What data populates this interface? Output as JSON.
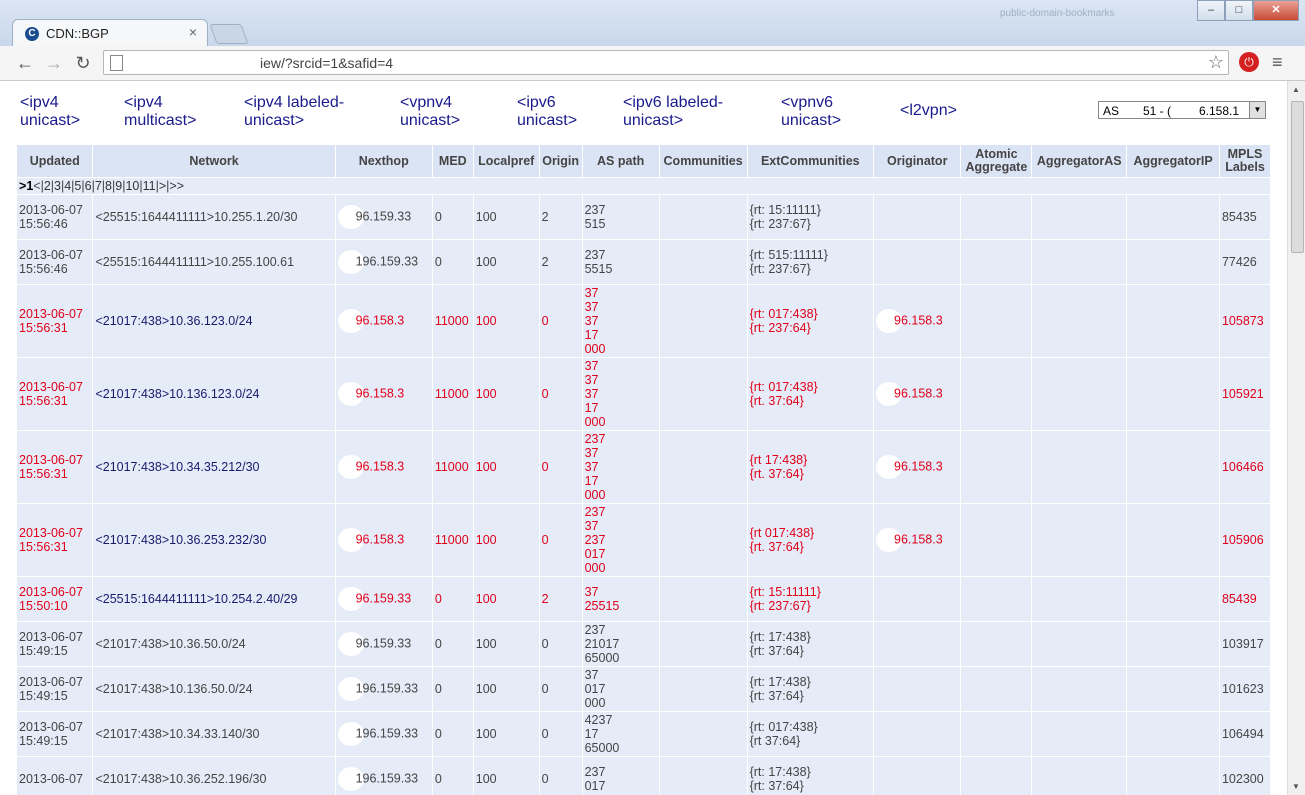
{
  "window": {
    "tab_title": "CDN::BGP",
    "url": "iew/?srcid=1&safid=4",
    "blurred_title": "public-domain-bookmarks"
  },
  "safi_links": [
    {
      "label": "<ipv4\nunicast>"
    },
    {
      "label": "<ipv4\nmulticast>"
    },
    {
      "label": "<ipv4 labeled-\nunicast>"
    },
    {
      "label": "<vpnv4\nunicast>"
    },
    {
      "label": "<ipv6\nunicast>"
    },
    {
      "label": "<ipv6 labeled-\nunicast>"
    },
    {
      "label": "<vpnv6\nunicast>"
    },
    {
      "label": "<l2vpn>"
    }
  ],
  "router_select": {
    "prefix": "AS",
    "middle": "51 - (",
    "suffix": "6.158.1"
  },
  "columns": [
    "Updated",
    "Network",
    "Nexthop",
    "MED",
    "Localpref",
    "Origin",
    "AS path",
    "Communities",
    "ExtCommunities",
    "Originator",
    "Atomic Aggregate",
    "AggregatorAS",
    "AggregatorIP",
    "MPLS Labels"
  ],
  "pager": {
    "prefix": ">",
    "current": "1",
    "pages": [
      "2",
      "3",
      "4",
      "5",
      "6",
      "7",
      "8",
      "9",
      "10",
      "11"
    ],
    "next": ">",
    "last": ">>"
  },
  "rows": [
    {
      "updated": "2013-06-07 15:56:46",
      "network": "<25515:1644411111>10.255.1.20/30",
      "nexthop": "96.159.33",
      "med": "0",
      "localpref": "100",
      "origin": "2",
      "aspath": "237\n515",
      "communities": "",
      "ext": "{rt:   15:11111}\n{rt:   237:67}",
      "originator": "",
      "atomic": "",
      "aggas": "",
      "aggip": "",
      "mpls": "85435",
      "red": false
    },
    {
      "updated": "2013-06-07 15:56:46",
      "network": "<25515:1644411111>10.255.100.61",
      "nexthop": "196.159.33",
      "med": "0",
      "localpref": "100",
      "origin": "2",
      "aspath": "237\n5515",
      "communities": "",
      "ext": "{rt:   515:11111}\n{rt:   237:67}",
      "originator": "",
      "atomic": "",
      "aggas": "",
      "aggip": "",
      "mpls": "77426",
      "red": false
    },
    {
      "updated": "2013-06-07 15:56:31",
      "network": "<21017:438>10.36.123.0/24",
      "nexthop": "96.158.3",
      "med": "11000",
      "localpref": "100",
      "origin": "0",
      "aspath": "37\n37\n37\n17\n000",
      "communities": "",
      "ext": "{rt:   017:438}\n{rt:   237:64}",
      "originator": "96.158.3",
      "atomic": "",
      "aggas": "",
      "aggip": "",
      "mpls": "105873",
      "red": true
    },
    {
      "updated": "2013-06-07 15:56:31",
      "network": "<21017:438>10.136.123.0/24",
      "nexthop": "96.158.3",
      "med": "11000",
      "localpref": "100",
      "origin": "0",
      "aspath": "37\n37\n37\n17\n000",
      "communities": "",
      "ext": "{rt:  017:438}\n{rt.   37:64}",
      "originator": "96.158.3",
      "atomic": "",
      "aggas": "",
      "aggip": "",
      "mpls": "105921",
      "red": true
    },
    {
      "updated": "2013-06-07 15:56:31",
      "network": "<21017:438>10.34.35.212/30",
      "nexthop": "96.158.3",
      "med": "11000",
      "localpref": "100",
      "origin": "0",
      "aspath": "237\n37\n37\n17\n000",
      "communities": "",
      "ext": "{rt   17:438}\n{rt.   37:64}",
      "originator": "96.158.3",
      "atomic": "",
      "aggas": "",
      "aggip": "",
      "mpls": "106466",
      "red": true
    },
    {
      "updated": "2013-06-07 15:56:31",
      "network": "<21017:438>10.36.253.232/30",
      "nexthop": "96.158.3",
      "med": "11000",
      "localpref": "100",
      "origin": "0",
      "aspath": "237\n37\n237\n017\n000",
      "communities": "",
      "ext": "{rt   017:438}\n{rt.   37:64}",
      "originator": "96.158.3",
      "atomic": "",
      "aggas": "",
      "aggip": "",
      "mpls": "105906",
      "red": true
    },
    {
      "updated": "2013-06-07 15:50:10",
      "network": "<25515:1644411111>10.254.2.40/29",
      "nexthop": "96.159.33",
      "med": "0",
      "localpref": "100",
      "origin": "2",
      "aspath": "37\n25515",
      "communities": "",
      "ext": "{rt:   15:11111}\n{rt:   237:67}",
      "originator": "",
      "atomic": "",
      "aggas": "",
      "aggip": "",
      "mpls": "85439",
      "red": true
    },
    {
      "updated": "2013-06-07 15:49:15",
      "network": "<21017:438>10.36.50.0/24",
      "nexthop": "96.159.33",
      "med": "0",
      "localpref": "100",
      "origin": "0",
      "aspath": "237\n21017\n65000",
      "communities": "",
      "ext": "{rt:   17:438}\n{rt:   37:64}",
      "originator": "",
      "atomic": "",
      "aggas": "",
      "aggip": "",
      "mpls": "103917",
      "red": false
    },
    {
      "updated": "2013-06-07 15:49:15",
      "network": "<21017:438>10.136.50.0/24",
      "nexthop": "196.159.33",
      "med": "0",
      "localpref": "100",
      "origin": "0",
      "aspath": "37\n017\n000",
      "communities": "",
      "ext": "{rt:   17:438}\n{rt:   37:64}",
      "originator": "",
      "atomic": "",
      "aggas": "",
      "aggip": "",
      "mpls": "101623",
      "red": false
    },
    {
      "updated": "2013-06-07 15:49:15",
      "network": "<21017:438>10.34.33.140/30",
      "nexthop": "196.159.33",
      "med": "0",
      "localpref": "100",
      "origin": "0",
      "aspath": "4237\n17\n65000",
      "communities": "",
      "ext": "{rt:  017:438}\n{rt   37:64}",
      "originator": "",
      "atomic": "",
      "aggas": "",
      "aggip": "",
      "mpls": "106494",
      "red": false
    },
    {
      "updated": "2013-06-07",
      "network": "<21017:438>10.36.252.196/30",
      "nexthop": "196.159.33",
      "med": "0",
      "localpref": "100",
      "origin": "0",
      "aspath": "237\n017",
      "communities": "",
      "ext": "{rt:   17:438}\n{rt:   37:64}",
      "originator": "",
      "atomic": "",
      "aggas": "",
      "aggip": "",
      "mpls": "102300",
      "red": false
    }
  ]
}
